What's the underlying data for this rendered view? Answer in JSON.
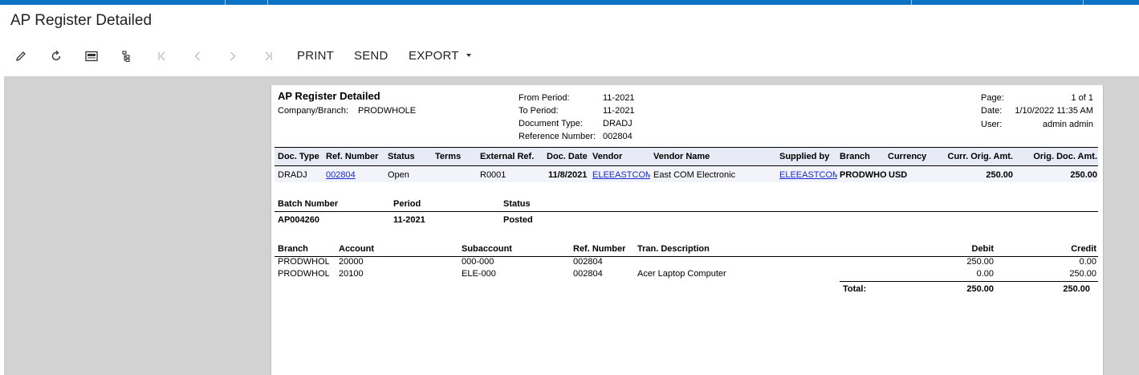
{
  "app": {
    "title": "AP Register Detailed"
  },
  "toolbar": {
    "icons": [
      "pencil-icon",
      "refresh-icon",
      "pdf-icon",
      "tree-icon",
      "first-page-icon",
      "prev-page-icon",
      "next-page-icon",
      "last-page-icon"
    ],
    "print_label": "PRINT",
    "send_label": "SEND",
    "export_label": "EXPORT"
  },
  "report": {
    "title": "AP Register Detailed",
    "company_label": "Company/Branch:",
    "company_value": "PRODWHOLE",
    "from_period_label": "From Period:",
    "from_period": "11-2021",
    "to_period_label": "To Period:",
    "to_period": "11-2021",
    "doc_type_label": "Document Type:",
    "doc_type": "DRADJ",
    "ref_num_label": "Reference Number:",
    "ref_num": "002804",
    "page_label": "Page:",
    "page": "1 of 1",
    "date_label": "Date:",
    "date": "1/10/2022 11:35 AM",
    "user_label": "User:",
    "user": "admin admin"
  },
  "doc_table": {
    "headers": [
      "Doc. Type",
      "Ref. Number",
      "Status",
      "Terms",
      "External Ref.",
      "Doc. Date",
      "Vendor",
      "Vendor Name",
      "Supplied by",
      "Branch",
      "Currency",
      "Curr. Orig. Amt.",
      "Orig. Doc. Amt."
    ],
    "row": [
      "DRADJ",
      "002804",
      "Open",
      "",
      "R0001",
      "11/8/2021",
      "ELEEASTCOM",
      "East COM Electronic",
      "ELEEASTCOM",
      "PRODWHOLE",
      "USD",
      "250.00",
      "250.00"
    ]
  },
  "batch_table": {
    "headers": [
      "Batch Number",
      "Period",
      "Status"
    ],
    "row": [
      "AP004260",
      "11-2021",
      "Posted"
    ]
  },
  "gl_table": {
    "headers": [
      "Branch",
      "Account",
      "Subaccount",
      "Ref. Number",
      "Tran. Description",
      "Debit",
      "Credit"
    ],
    "rows": [
      [
        "PRODWHOLE",
        "20000",
        "000-000",
        "002804",
        "",
        "250.00",
        "0.00"
      ],
      [
        "PRODWHOLE",
        "20100",
        "ELE-000",
        "002804",
        "Acer Laptop Computer",
        "0.00",
        "250.00"
      ]
    ],
    "total_label": "Total:",
    "total_debit": "250.00",
    "total_credit": "250.00"
  }
}
